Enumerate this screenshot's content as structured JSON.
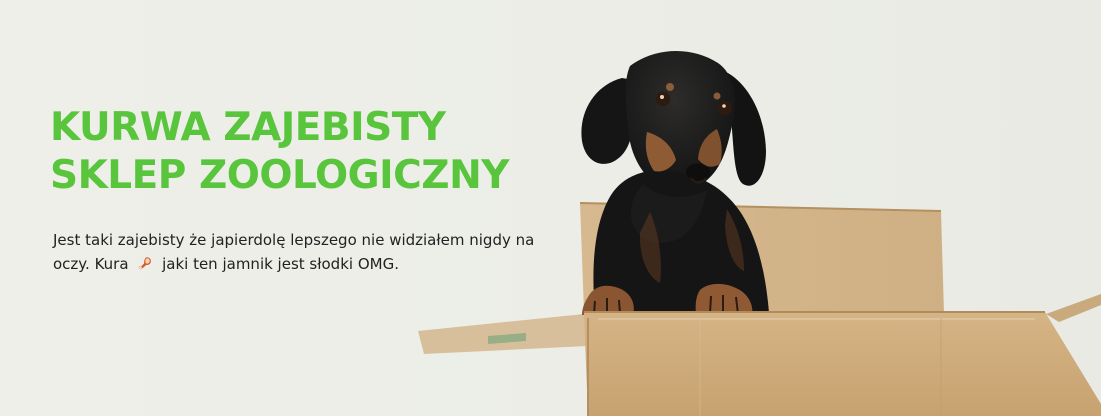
{
  "hero": {
    "title_line1": "KURWA ZAJEBISTY",
    "title_line2": "SKLEP ZOOLOGICZNY",
    "description_before": "Jest taki zajebisty że japierdolę lepszego nie widziałem nigdy na oczy. Kura",
    "description_after": " jaki ten jamnik jest słodki OMG.",
    "emoji_icon": "chicken-leg-icon",
    "title_color": "#58c53c"
  },
  "image": {
    "subject": "dachshund-in-cardboard-box"
  }
}
